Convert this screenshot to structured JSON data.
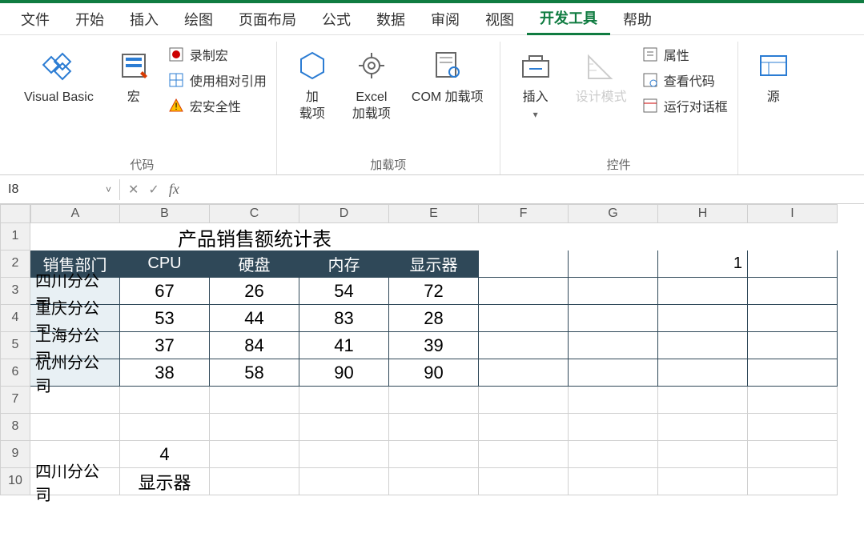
{
  "menu": {
    "file": "文件",
    "home": "开始",
    "insert": "插入",
    "draw": "绘图",
    "layout": "页面布局",
    "formulas": "公式",
    "data": "数据",
    "review": "审阅",
    "view": "视图",
    "developer": "开发工具",
    "help": "帮助"
  },
  "ribbon": {
    "code_group": "代码",
    "visual_basic": "Visual Basic",
    "macros": "宏",
    "record_macro": "录制宏",
    "relative_ref": "使用相对引用",
    "macro_security": "宏安全性",
    "addins_group": "加载项",
    "addins": "加\n载项",
    "excel_addins": "Excel\n加载项",
    "com_addins": "COM 加载项",
    "insert_ctrl": "插入",
    "design_mode": "设计模式",
    "controls_group": "控件",
    "properties": "属性",
    "view_code": "查看代码",
    "run_dialog": "运行对话框",
    "source": "源"
  },
  "namebox": "I8",
  "cols": [
    "A",
    "B",
    "C",
    "D",
    "E",
    "F",
    "G",
    "H",
    "I"
  ],
  "title": "产品销售额统计表",
  "headers": [
    "销售部门",
    "CPU",
    "硬盘",
    "内存",
    "显示器"
  ],
  "data_rows": [
    {
      "dept": "四川分公司",
      "v": [
        "67",
        "26",
        "54",
        "72"
      ]
    },
    {
      "dept": "重庆分公司",
      "v": [
        "53",
        "44",
        "83",
        "28"
      ]
    },
    {
      "dept": "上海分公司",
      "v": [
        "37",
        "84",
        "41",
        "39"
      ]
    },
    {
      "dept": "杭州分公司",
      "v": [
        "38",
        "58",
        "90",
        "90"
      ]
    }
  ],
  "extra": {
    "h2": "1",
    "b9": "4",
    "a10": "四川分公司",
    "b10": "显示器"
  }
}
